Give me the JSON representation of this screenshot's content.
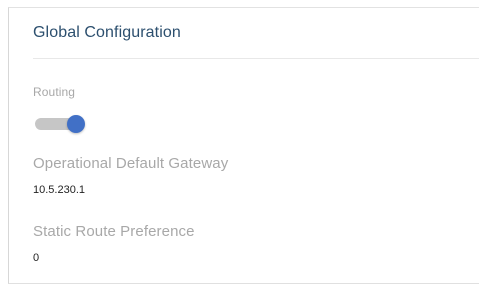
{
  "panel": {
    "title": "Global Configuration"
  },
  "routing": {
    "label": "Routing",
    "enabled": true,
    "accent_color": "#4170c6",
    "track_color": "#c6c6c6"
  },
  "gateway": {
    "label": "Operational Default Gateway",
    "value": "10.5.230.1"
  },
  "static_route": {
    "label": "Static Route Preference",
    "value": "0"
  }
}
